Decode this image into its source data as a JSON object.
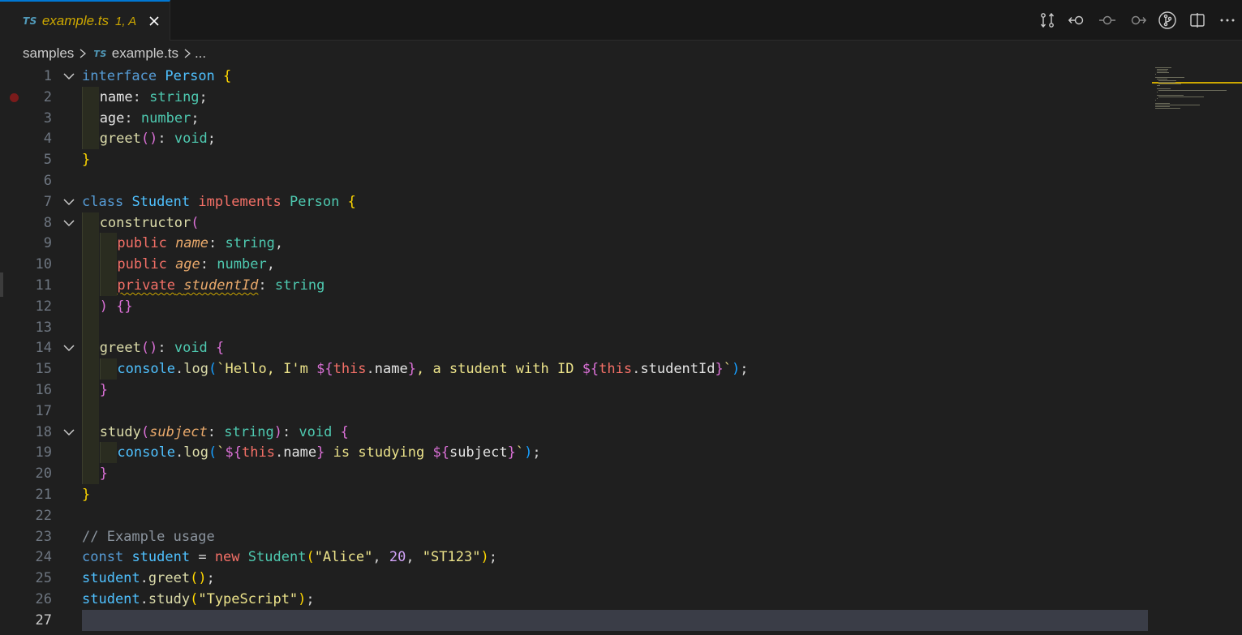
{
  "tab": {
    "lang_badge": "TS",
    "filename": "example.ts",
    "status": "1, A"
  },
  "actions": [
    {
      "icon": "compare-changes-icon"
    },
    {
      "icon": "go-back-icon"
    },
    {
      "icon": "timeline-icon"
    },
    {
      "icon": "go-forward-icon"
    },
    {
      "icon": "source-control-icon"
    },
    {
      "icon": "split-editor-icon"
    },
    {
      "icon": "more-actions-icon"
    }
  ],
  "breadcrumb": {
    "folder": "samples",
    "lang_badge": "TS",
    "file": "example.ts",
    "more": "..."
  },
  "editor": {
    "active_line": 27,
    "breakpoint_line": 2,
    "lines": [
      {
        "n": "1",
        "fold": true,
        "guides": 0,
        "tokens": [
          [
            "kw",
            "interface"
          ],
          [
            "op",
            " "
          ],
          [
            "ty",
            "Person"
          ],
          [
            "op",
            " "
          ],
          [
            "b1",
            "{"
          ]
        ]
      },
      {
        "n": "2",
        "guides": 1,
        "tokens": [
          [
            "prop",
            "name"
          ],
          [
            "op",
            ": "
          ],
          [
            "prim",
            "string"
          ],
          [
            "op",
            ";"
          ]
        ]
      },
      {
        "n": "3",
        "guides": 1,
        "tokens": [
          [
            "prop",
            "age"
          ],
          [
            "op",
            ": "
          ],
          [
            "prim",
            "number"
          ],
          [
            "op",
            ";"
          ]
        ]
      },
      {
        "n": "4",
        "guides": 1,
        "tokens": [
          [
            "fn",
            "greet"
          ],
          [
            "b2",
            "()"
          ],
          [
            "op",
            ": "
          ],
          [
            "prim",
            "void"
          ],
          [
            "op",
            ";"
          ]
        ]
      },
      {
        "n": "5",
        "guides": 0,
        "tokens": [
          [
            "b1",
            "}"
          ]
        ]
      },
      {
        "n": "6",
        "guides": 0,
        "tokens": []
      },
      {
        "n": "7",
        "fold": true,
        "guides": 0,
        "tokens": [
          [
            "kw",
            "class"
          ],
          [
            "op",
            " "
          ],
          [
            "ty",
            "Student"
          ],
          [
            "op",
            " "
          ],
          [
            "mod",
            "implements"
          ],
          [
            "op",
            " "
          ],
          [
            "cls",
            "Person"
          ],
          [
            "op",
            " "
          ],
          [
            "b1",
            "{"
          ]
        ]
      },
      {
        "n": "8",
        "fold": true,
        "guides": 1,
        "tokens": [
          [
            "fn",
            "constructor"
          ],
          [
            "b2",
            "("
          ]
        ]
      },
      {
        "n": "9",
        "guides": 2,
        "tokens": [
          [
            "mod",
            "public"
          ],
          [
            "op",
            " "
          ],
          [
            "par",
            "name"
          ],
          [
            "op",
            ": "
          ],
          [
            "prim",
            "string"
          ],
          [
            "op",
            ","
          ]
        ]
      },
      {
        "n": "10",
        "guides": 2,
        "tokens": [
          [
            "mod",
            "public"
          ],
          [
            "op",
            " "
          ],
          [
            "par",
            "age"
          ],
          [
            "op",
            ": "
          ],
          [
            "prim",
            "number"
          ],
          [
            "op",
            ","
          ]
        ]
      },
      {
        "n": "11",
        "guides": 2,
        "tokens": [
          [
            "mod squiggle",
            "private"
          ],
          [
            "squiggle",
            " "
          ],
          [
            "par squiggle",
            "studentId"
          ],
          [
            "op",
            ": "
          ],
          [
            "prim",
            "string"
          ]
        ]
      },
      {
        "n": "12",
        "guides": 1,
        "tokens": [
          [
            "b2",
            ")"
          ],
          [
            "op",
            " "
          ],
          [
            "b2",
            "{}"
          ]
        ]
      },
      {
        "n": "13",
        "guides": 1,
        "tokens": []
      },
      {
        "n": "14",
        "fold": true,
        "guides": 1,
        "tokens": [
          [
            "fn",
            "greet"
          ],
          [
            "b2",
            "()"
          ],
          [
            "op",
            ": "
          ],
          [
            "prim",
            "void"
          ],
          [
            "op",
            " "
          ],
          [
            "b2",
            "{"
          ]
        ]
      },
      {
        "n": "15",
        "guides": 2,
        "tokens": [
          [
            "ty",
            "console"
          ],
          [
            "op",
            "."
          ],
          [
            "fn",
            "log"
          ],
          [
            "b3",
            "("
          ],
          [
            "str",
            "`Hello, I'm "
          ],
          [
            "b2",
            "${"
          ],
          [
            "this",
            "this"
          ],
          [
            "op",
            "."
          ],
          [
            "prop",
            "name"
          ],
          [
            "b2",
            "}"
          ],
          [
            "str",
            ", a student with ID "
          ],
          [
            "b2",
            "${"
          ],
          [
            "this",
            "this"
          ],
          [
            "op",
            "."
          ],
          [
            "prop",
            "studentId"
          ],
          [
            "b2",
            "}"
          ],
          [
            "str",
            "`"
          ],
          [
            "b3",
            ")"
          ],
          [
            "op",
            ";"
          ]
        ]
      },
      {
        "n": "16",
        "guides": 1,
        "tokens": [
          [
            "b2",
            "}"
          ]
        ]
      },
      {
        "n": "17",
        "guides": 1,
        "tokens": []
      },
      {
        "n": "18",
        "fold": true,
        "guides": 1,
        "tokens": [
          [
            "fn",
            "study"
          ],
          [
            "b2",
            "("
          ],
          [
            "par",
            "subject"
          ],
          [
            "op",
            ": "
          ],
          [
            "prim",
            "string"
          ],
          [
            "b2",
            ")"
          ],
          [
            "op",
            ": "
          ],
          [
            "prim",
            "void"
          ],
          [
            "op",
            " "
          ],
          [
            "b2",
            "{"
          ]
        ]
      },
      {
        "n": "19",
        "guides": 2,
        "tokens": [
          [
            "ty",
            "console"
          ],
          [
            "op",
            "."
          ],
          [
            "fn",
            "log"
          ],
          [
            "b3",
            "("
          ],
          [
            "str",
            "`"
          ],
          [
            "b2",
            "${"
          ],
          [
            "this",
            "this"
          ],
          [
            "op",
            "."
          ],
          [
            "prop",
            "name"
          ],
          [
            "b2",
            "}"
          ],
          [
            "str",
            " is studying "
          ],
          [
            "b2",
            "${"
          ],
          [
            "prop",
            "subject"
          ],
          [
            "b2",
            "}"
          ],
          [
            "str",
            "`"
          ],
          [
            "b3",
            ")"
          ],
          [
            "op",
            ";"
          ]
        ]
      },
      {
        "n": "20",
        "guides": 1,
        "tokens": [
          [
            "b2",
            "}"
          ]
        ]
      },
      {
        "n": "21",
        "guides": 0,
        "tokens": [
          [
            "b1",
            "}"
          ]
        ]
      },
      {
        "n": "22",
        "guides": 0,
        "tokens": []
      },
      {
        "n": "23",
        "guides": 0,
        "tokens": [
          [
            "gray",
            "// Example usage"
          ]
        ]
      },
      {
        "n": "24",
        "guides": 0,
        "tokens": [
          [
            "kw",
            "const"
          ],
          [
            "op",
            " "
          ],
          [
            "ty",
            "student"
          ],
          [
            "op",
            " = "
          ],
          [
            "mod",
            "new"
          ],
          [
            "op",
            " "
          ],
          [
            "cls",
            "Student"
          ],
          [
            "b1",
            "("
          ],
          [
            "str",
            "\"Alice\""
          ],
          [
            "op",
            ", "
          ],
          [
            "num",
            "20"
          ],
          [
            "op",
            ", "
          ],
          [
            "str",
            "\"ST123\""
          ],
          [
            "b1",
            ")"
          ],
          [
            "op",
            ";"
          ]
        ]
      },
      {
        "n": "25",
        "guides": 0,
        "tokens": [
          [
            "ty",
            "student"
          ],
          [
            "op",
            "."
          ],
          [
            "fn",
            "greet"
          ],
          [
            "b1",
            "()"
          ],
          [
            "op",
            ";"
          ]
        ]
      },
      {
        "n": "26",
        "guides": 0,
        "tokens": [
          [
            "ty",
            "student"
          ],
          [
            "op",
            "."
          ],
          [
            "fn",
            "study"
          ],
          [
            "b1",
            "("
          ],
          [
            "str",
            "\"TypeScript\""
          ],
          [
            "b1",
            ")"
          ],
          [
            "op",
            ";"
          ]
        ]
      },
      {
        "n": "27",
        "guides": 0,
        "tokens": []
      }
    ]
  }
}
